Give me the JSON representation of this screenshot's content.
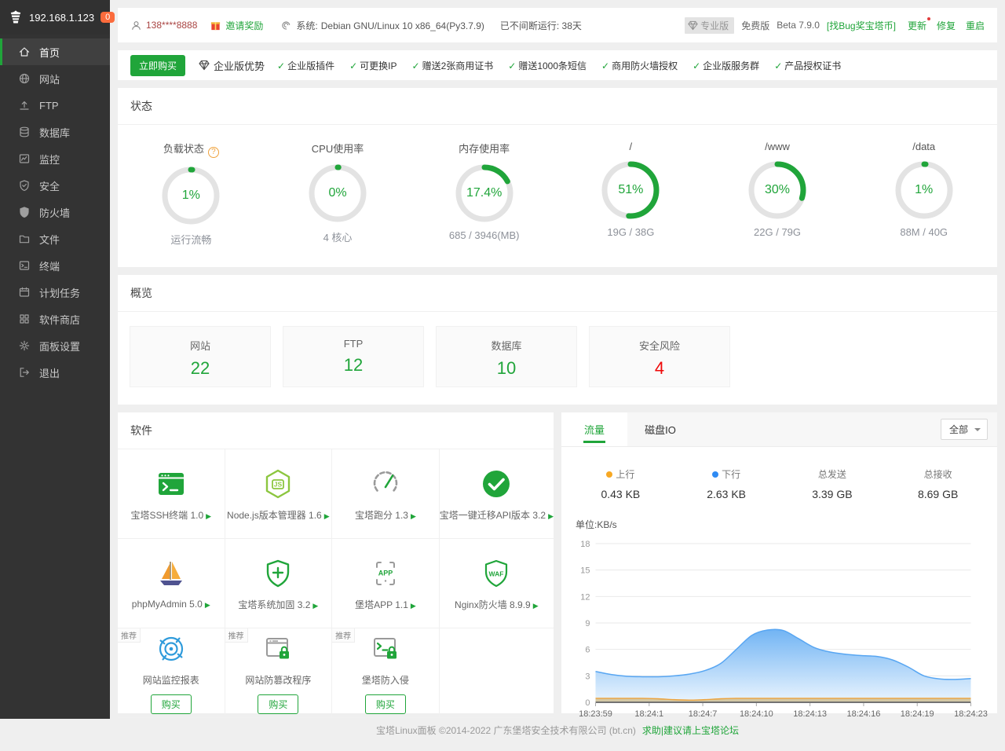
{
  "colors": {
    "accent": "#20a53a",
    "red": "#ef0808",
    "orange_badge": "#fb6b3c",
    "chart_down": "#58a6f2",
    "chart_up": "#eda33c"
  },
  "sidebar": {
    "ip": "192.168.1.123",
    "badge": "0",
    "items": [
      {
        "key": "home",
        "label": "首页",
        "icon": "home-icon",
        "active": true
      },
      {
        "key": "sites",
        "label": "网站",
        "icon": "globe-icon"
      },
      {
        "key": "ftp",
        "label": "FTP",
        "icon": "upload-icon"
      },
      {
        "key": "database",
        "label": "数据库",
        "icon": "database-icon"
      },
      {
        "key": "monitor",
        "label": "监控",
        "icon": "monitor-icon"
      },
      {
        "key": "security",
        "label": "安全",
        "icon": "shield-check-icon"
      },
      {
        "key": "firewall",
        "label": "防火墙",
        "icon": "shield-filled-icon"
      },
      {
        "key": "files",
        "label": "文件",
        "icon": "folder-icon"
      },
      {
        "key": "terminal",
        "label": "终端",
        "icon": "terminal-icon"
      },
      {
        "key": "cron",
        "label": "计划任务",
        "icon": "calendar-icon"
      },
      {
        "key": "appstore",
        "label": "软件商店",
        "icon": "grid-icon"
      },
      {
        "key": "settings",
        "label": "面板设置",
        "icon": "gear-icon"
      },
      {
        "key": "logout",
        "label": "退出",
        "icon": "logout-icon"
      }
    ]
  },
  "topbar": {
    "phone": "138****8888",
    "invite": "邀请奖励",
    "system_label": "系统:",
    "system_value": "Debian GNU/Linux 10 x86_64(Py3.7.9)",
    "uptime": "已不间断运行: 38天",
    "pro_badge": "专业版",
    "free_label": "免费版",
    "beta": "Beta 7.9.0",
    "bug_link": "[找Bug奖宝塔币]",
    "update": "更新",
    "repair": "修复",
    "restart": "重启"
  },
  "promo": {
    "buy_button": "立即购买",
    "title": "企业版优势",
    "features": [
      "企业版插件",
      "可更换IP",
      "赠送2张商用证书",
      "赠送1000条短信",
      "商用防火墙授权",
      "企业版服务群",
      "产品授权证书"
    ]
  },
  "status": {
    "title": "状态",
    "gauges": [
      {
        "key": "load",
        "label": "负载状态",
        "has_help": true,
        "percent": 1,
        "value": "1%",
        "sub": "运行流畅"
      },
      {
        "key": "cpu",
        "label": "CPU使用率",
        "has_help": false,
        "percent": 0,
        "value": "0%",
        "sub": "4 核心"
      },
      {
        "key": "memory",
        "label": "内存使用率",
        "has_help": false,
        "percent": 17.4,
        "value": "17.4%",
        "sub": "685 / 3946(MB)"
      },
      {
        "key": "disk-root",
        "label": "/",
        "has_help": false,
        "percent": 51,
        "value": "51%",
        "sub": "19G / 38G"
      },
      {
        "key": "disk-www",
        "label": "/www",
        "has_help": false,
        "percent": 30,
        "value": "30%",
        "sub": "22G / 79G"
      },
      {
        "key": "disk-data",
        "label": "/data",
        "has_help": false,
        "percent": 1,
        "value": "1%",
        "sub": "88M / 40G"
      }
    ]
  },
  "overview": {
    "title": "概览",
    "cards": [
      {
        "key": "sites",
        "label": "网站",
        "value": "22",
        "color": "#20a53a"
      },
      {
        "key": "ftp",
        "label": "FTP",
        "value": "12",
        "color": "#20a53a"
      },
      {
        "key": "database",
        "label": "数据库",
        "value": "10",
        "color": "#20a53a"
      },
      {
        "key": "security-risk",
        "label": "安全风险",
        "value": "4",
        "color": "#ef0808"
      }
    ]
  },
  "software": {
    "title": "软件",
    "items": [
      {
        "key": "ssh-terminal",
        "name": "宝塔SSH终端 1.0",
        "icon": "terminal-app-icon",
        "has_play": true
      },
      {
        "key": "nodejs-manager",
        "name": "Node.js版本管理器 1.6",
        "icon": "nodejs-icon",
        "has_play": true
      },
      {
        "key": "benchmark",
        "name": "宝塔跑分 1.3",
        "icon": "speedometer-icon",
        "has_play": true
      },
      {
        "key": "migration-api",
        "name": "宝塔一键迁移API版本 3.2",
        "icon": "check-circle-icon",
        "has_play": true
      },
      {
        "key": "phpmyadmin",
        "name": "phpMyAdmin 5.0",
        "icon": "sailboat-icon",
        "has_play": true
      },
      {
        "key": "system-hardening",
        "name": "宝塔系统加固 3.2",
        "icon": "shield-plus-icon",
        "has_play": true
      },
      {
        "key": "bt-app",
        "name": "堡塔APP 1.1",
        "icon": "phone-app-icon",
        "has_play": true
      },
      {
        "key": "nginx-waf",
        "name": "Nginx防火墙 8.9.9",
        "icon": "shield-waf-icon",
        "has_play": true
      },
      {
        "key": "site-monitor-report",
        "name": "网站监控报表",
        "icon": "radar-icon",
        "tag": "推荐",
        "buy": "购买"
      },
      {
        "key": "tamper-proof",
        "name": "网站防篡改程序",
        "icon": "window-lock-icon",
        "tag": "推荐",
        "buy": "购买"
      },
      {
        "key": "intrusion-prevention",
        "name": "堡塔防入侵",
        "icon": "terminal-lock-icon",
        "tag": "推荐",
        "buy": "购买"
      }
    ]
  },
  "traffic": {
    "tabs": [
      "流量",
      "磁盘IO"
    ],
    "active_tab": "流量",
    "filter": "全部",
    "stats": [
      {
        "key": "up",
        "label": "上行",
        "value": "0.43 KB",
        "dot": "#f7a823"
      },
      {
        "key": "down",
        "label": "下行",
        "value": "2.63 KB",
        "dot": "#2f8bf3"
      },
      {
        "key": "total-sent",
        "label": "总发送",
        "value": "3.39 GB"
      },
      {
        "key": "total-received",
        "label": "总接收",
        "value": "8.69 GB"
      }
    ],
    "unit": "单位:KB/s"
  },
  "chart_data": {
    "type": "area",
    "title": "流量",
    "ylabel": "单位:KB/s",
    "ylim": [
      0,
      18
    ],
    "yticks": [
      0,
      3,
      6,
      9,
      12,
      15,
      18
    ],
    "x": [
      "18:23:59",
      "18:24:1",
      "18:24:7",
      "18:24:10",
      "18:24:13",
      "18:24:16",
      "18:24:19",
      "18:24:23"
    ],
    "grid": true,
    "legend_position": "top",
    "series": [
      {
        "name": "下行",
        "color": "#58a6f2",
        "values": [
          3.5,
          3.15,
          2.95,
          2.9,
          2.9,
          3.0,
          3.2,
          3.6,
          4.4,
          6.0,
          7.6,
          8.2,
          8.15,
          7.2,
          6.2,
          5.7,
          5.45,
          5.3,
          5.2,
          4.8,
          4.0,
          3.0,
          2.65,
          2.6,
          2.7
        ]
      },
      {
        "name": "上行",
        "color": "#eda33c",
        "values": [
          0.45,
          0.45,
          0.45,
          0.45,
          0.4,
          0.3,
          0.25,
          0.3,
          0.4,
          0.45,
          0.45,
          0.45,
          0.45,
          0.45,
          0.45,
          0.45,
          0.45,
          0.45,
          0.45,
          0.45,
          0.45,
          0.45,
          0.45,
          0.45,
          0.45
        ]
      }
    ]
  },
  "footer": {
    "text": "宝塔Linux面板 ©2014-2022 广东堡塔安全技术有限公司 (bt.cn)",
    "link": "求助|建议请上宝塔论坛"
  }
}
